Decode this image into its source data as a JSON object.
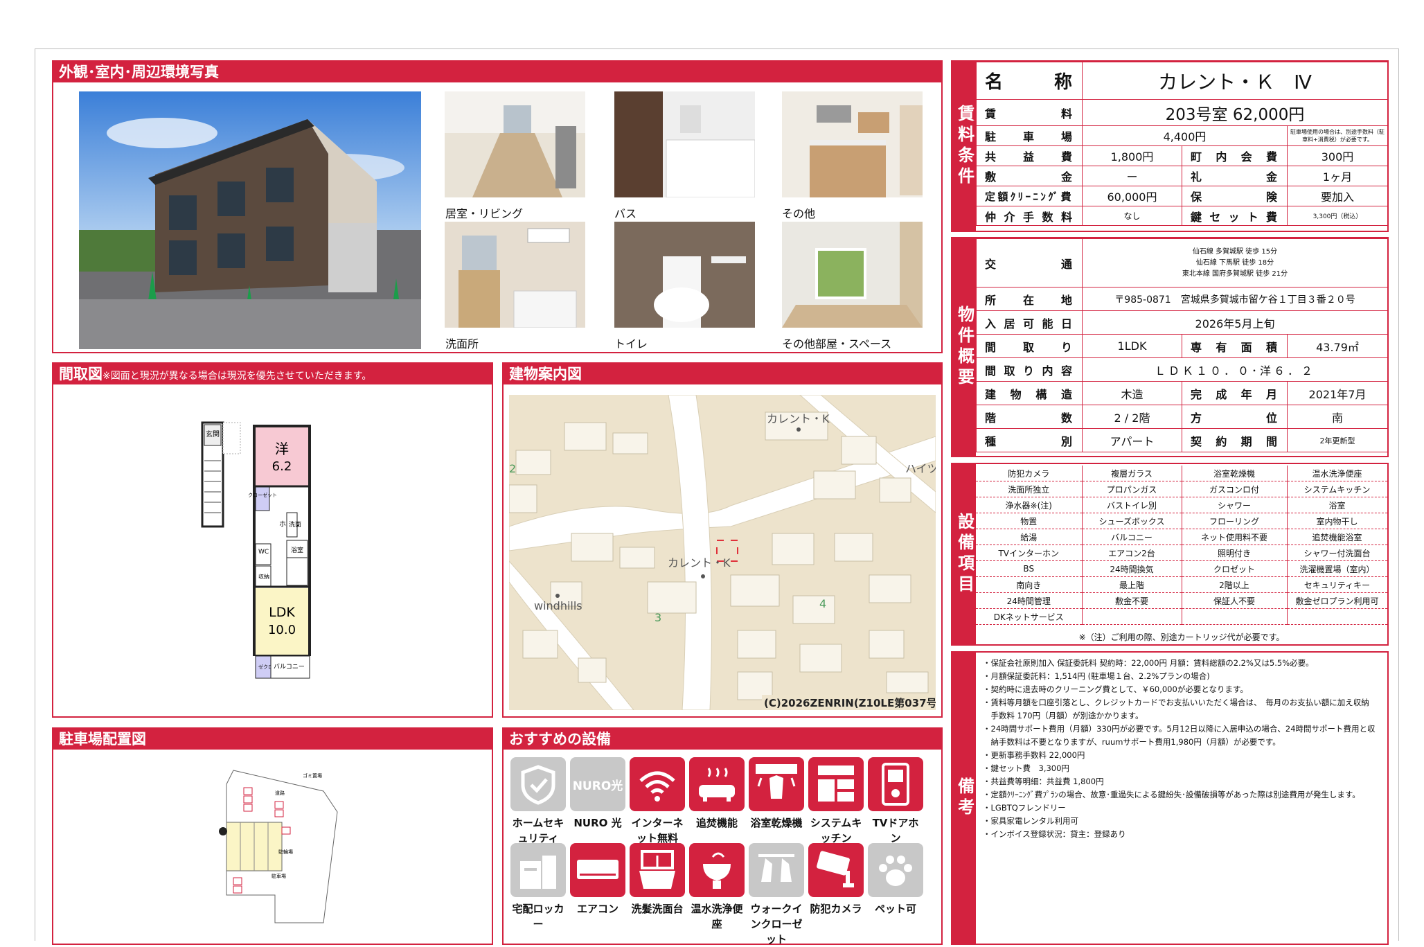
{
  "photos_section": {
    "title": "外観･室内･周辺環境写真",
    "captions": [
      "居室・リビング",
      "バス",
      "その他",
      "洗面所",
      "トイレ",
      "その他部屋・スペース"
    ]
  },
  "floorplan": {
    "title": "間取図",
    "note": "※図面と現況が異なる場合は現況を優先させていただきます。",
    "room_western_label": "洋",
    "room_western_size": "6.2",
    "room_ldk_label": "LDK",
    "room_ldk_size": "10.0",
    "labels": {
      "entrance": "玄関",
      "closet": "クローゼット",
      "hall": "ホール",
      "wash": "洗面",
      "bath": "浴室",
      "wc": "WC",
      "storage": "収納",
      "closet2": "ゼクロト",
      "balcony": "バルコニー"
    }
  },
  "map": {
    "title": "建物案内図",
    "name_top": "カレント・K",
    "name_mid": "カレント・K",
    "name_left": "windhills",
    "name_right": "ハイツ",
    "block3": "3",
    "block4": "4",
    "block2": "2",
    "copyright": "(C)2026ZENRIN(Z10LE第037号)"
  },
  "parking": {
    "title": "駐車場配置図",
    "label_garbage": "ゴミ置場",
    "label_road": "道路",
    "label_parking": "駐輪場",
    "label_parking2": "駐車場"
  },
  "recommended": {
    "title": "おすすめの設備",
    "items": [
      {
        "label": "ホームセキュリティ",
        "on": false,
        "icon": "shield-icon"
      },
      {
        "label": "NURO 光",
        "on": false,
        "icon": "nuro-icon",
        "icon_text": "NURO光"
      },
      {
        "label": "インターネット無料",
        "on": true,
        "icon": "wifi-icon"
      },
      {
        "label": "追焚機能",
        "on": true,
        "icon": "bathtub-icon"
      },
      {
        "label": "浴室乾燥機",
        "on": true,
        "icon": "bath-dryer-icon"
      },
      {
        "label": "システムキッチン",
        "on": true,
        "icon": "kitchen-icon"
      },
      {
        "label": "TVドアホン",
        "on": true,
        "icon": "intercom-icon"
      },
      {
        "label": "宅配ロッカー",
        "on": false,
        "icon": "locker-icon"
      },
      {
        "label": "エアコン",
        "on": true,
        "icon": "aircon-icon"
      },
      {
        "label": "洗髪洗面台",
        "on": true,
        "icon": "washbasin-icon"
      },
      {
        "label": "温水洗浄便座",
        "on": true,
        "icon": "toilet-icon"
      },
      {
        "label": "ウォークインクローゼット",
        "on": false,
        "icon": "closet-icon"
      },
      {
        "label": "防犯カメラ",
        "on": true,
        "icon": "camera-icon"
      },
      {
        "label": "ペット可",
        "on": false,
        "icon": "paw-icon"
      }
    ]
  },
  "rental": {
    "tab": "賃料条件",
    "name_label": "名称",
    "name_value": "カレント・Ｋ　Ⅳ",
    "rent_label": "賃料",
    "rent_value": "203号室 62,000円",
    "parking_label": "駐車場",
    "parking_value": "4,400円",
    "parking_note": "駐車場使用の場合は、別途手数料（駐車料+消費税）が必要です。",
    "common_label": "共益費",
    "common_value": "1,800円",
    "town_label": "町内会費",
    "town_value": "300円",
    "deposit_label": "敷金",
    "deposit_value": "ー",
    "key_money_label": "礼金",
    "key_money_value": "1ヶ月",
    "cleaning_label": "定額ｸﾘｰﾆﾝｸﾞ費",
    "cleaning_value": "60,000円",
    "insurance_label": "保険",
    "insurance_value": "要加入",
    "agency_label": "仲介手数料",
    "agency_value": "なし",
    "keyset_label": "鍵セット費",
    "keyset_value": "3,300円（税込）"
  },
  "property": {
    "tab": "物件概要",
    "transport_label": "交通",
    "transport_lines": [
      "仙石線 多賀城駅 徒歩 15分",
      "仙石線 下馬駅 徒歩 18分",
      "東北本線 国府多賀城駅 徒歩 21分"
    ],
    "address_label": "所在地",
    "address_value": "〒985-0871　宮城県多賀城市留ケ谷１丁目３番２０号",
    "movein_label": "入居可能日",
    "movein_value": "2026年5月上旬",
    "layout_label": "間取り",
    "layout_value": "1LDK",
    "area_label": "専有面積",
    "area_value": "43.79㎡",
    "detail_label": "間取り内容",
    "detail_value": "ＬＤＫ１０．０･洋６．２",
    "structure_label": "建物構造",
    "structure_value": "木造",
    "built_label": "完成年月",
    "built_value": "2021年7月",
    "floors_label": "階数",
    "floors_value": "2 / 2階",
    "direction_label": "方位",
    "direction_value": "南",
    "type_label": "種別",
    "type_value": "アパート",
    "contract_label": "契約期間",
    "contract_value": "2年更新型"
  },
  "equipment": {
    "tab": "設備項目",
    "rows": [
      [
        "防犯カメラ",
        "複層ガラス",
        "浴室乾燥機",
        "温水洗浄便座"
      ],
      [
        "洗面所独立",
        "プロパンガス",
        "ガスコンロ付",
        "システムキッチン"
      ],
      [
        "浄水器※(注)",
        "バストイレ別",
        "シャワー",
        "浴室"
      ],
      [
        "物置",
        "シューズボックス",
        "フローリング",
        "室内物干し"
      ],
      [
        "給湯",
        "バルコニー",
        "ネット使用料不要",
        "追焚機能浴室"
      ],
      [
        "TVインターホン",
        "エアコン2台",
        "照明付き",
        "シャワー付洗面台"
      ],
      [
        "BS",
        "24時間換気",
        "クロゼット",
        "洗濯機置場（室内）"
      ],
      [
        "南向き",
        "最上階",
        "2階以上",
        "セキュリティキー"
      ],
      [
        "24時間管理",
        "敷金不要",
        "保証人不要",
        "敷金ゼロプラン利用可"
      ],
      [
        "DKネットサービス",
        "",
        "",
        ""
      ]
    ],
    "footnote": "※（注）ご利用の際、別途カートリッジ代が必要です。"
  },
  "remarks": {
    "tab": "備考",
    "lines": [
      "・保証会社原則加入 保証委託料 契約時：22,000円 月額：賃料総額の2.2%又は5.5%必要。",
      "・月額保証委託料：1,514円 (駐車場１台、2.2%プランの場合)",
      "・契約時に退去時のクリーニング費として、￥60,000が必要となります。",
      "・賃料等月額を口座引落とし、クレジットカードでお支払いいただく場合は、　毎月のお支払い額に加え収納",
      "　手数料 170円（月額）が別途かかります。",
      "・24時間サポート費用（月額）330円が必要です。5月12日以降に入居申込の場合、24時間サポート費用と収",
      "　納手数料は不要となりますが、ruumサポート費用1,980円（月額）が必要です。",
      "・更新事務手数料 22,000円",
      "・鍵セット費　3,300円",
      "・共益費等明細：共益費 1,800円",
      "・定額ｸﾘｰﾆﾝｸﾞ費ﾌﾟﾗﾝの場合、故意･重過失による鍵紛失･設備破損等があった際は別途費用が発生します。",
      "・LGBTQフレンドリー",
      "・家具家電レンタル利用可",
      "・インボイス登録状況：貸主：登録あり"
    ]
  },
  "colors": {
    "accent": "#d3223f",
    "disabled": "#c8c8c8"
  }
}
